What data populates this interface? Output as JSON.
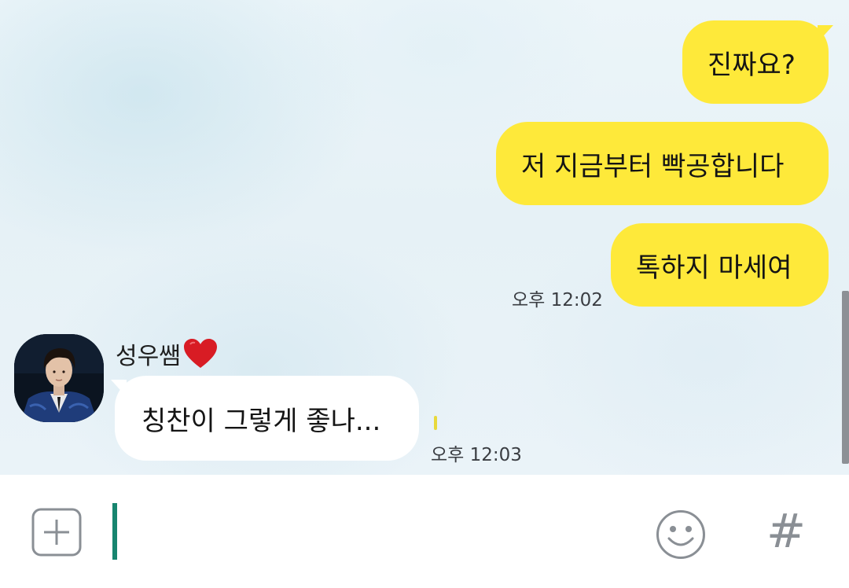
{
  "messages_sent": [
    {
      "text": "진짜요?"
    },
    {
      "text": "저 지금부터 빡공합니다"
    },
    {
      "text": "톡하지 마세여"
    }
  ],
  "sent_time": "오후 12:02",
  "received": {
    "sender_name": "성우쌤",
    "sender_emoji": "❤️",
    "text": "칭찬이 그렇게 좋나...",
    "time": "오후 12:03"
  },
  "input_bar": {
    "plus_icon": "plus-box-icon",
    "emoji_icon": "smiley-icon",
    "hashtag_symbol": "#"
  },
  "colors": {
    "my_bubble": "#fee93a",
    "their_bubble": "#ffffff",
    "caret": "#17856f",
    "icon_gray": "#8a8f95"
  }
}
